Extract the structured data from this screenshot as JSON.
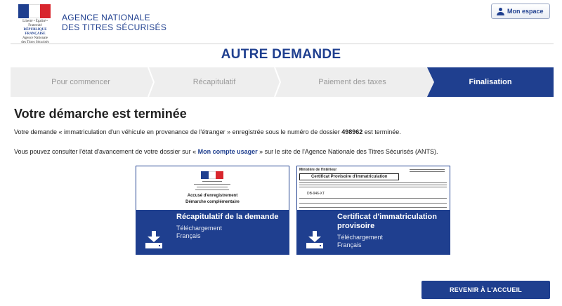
{
  "header": {
    "logo": {
      "motto": "Liberté • Égalité • Fraternité",
      "republic": "RÉPUBLIQUE FRANÇAISE",
      "agency_small_1": "Agence Nationale",
      "agency_small_2": "des Titres Sécurisés",
      "colors": {
        "blue": "#1f3f8f",
        "red": "#d8262d"
      }
    },
    "agency_line1": "AGENCE NATIONALE",
    "agency_line2": "DES TITRES SÉCURISÉS",
    "account_button": {
      "icon": "user-icon",
      "label": "Mon espace"
    }
  },
  "page_title": "AUTRE DEMANDE",
  "steps": [
    {
      "label": "Pour commencer",
      "active": false
    },
    {
      "label": "Récapitulatif",
      "active": false
    },
    {
      "label": "Paiement des taxes",
      "active": false
    },
    {
      "label": "Finalisation",
      "active": true
    }
  ],
  "content": {
    "heading": "Votre démarche est terminée",
    "para1_prefix": "Votre demande « immatriculation d'un véhicule en provenance de l'étranger » enregistrée sous le numéro de dossier ",
    "dossier_number": "498962",
    "para1_suffix": " est terminée.",
    "para2_prefix": "Vous pouvez consulter l'état d'avancement de votre dossier sur « ",
    "para2_link": "Mon compte usager",
    "para2_suffix": " » sur le site de l'Agence Nationale des Titres Sécurisés (ANTS)."
  },
  "cards": [
    {
      "title": "Récapitulatif de la demande",
      "sub1": "Téléchargement",
      "sub2": "Français",
      "icon": "download-icon",
      "thumb": {
        "line1": "Accusé d'enregistrement",
        "line2": "Démarche complémentaire"
      }
    },
    {
      "title": "Certificat d'immatriculation provisoire",
      "sub1": "Téléchargement",
      "sub2": "Français",
      "icon": "download-icon",
      "thumb": {
        "ministry": "Ministère de l'Intérieur",
        "title": "Certificat Provisoire d'Immatriculation",
        "plate": "DB-946-XT"
      }
    }
  ],
  "footer": {
    "back_button": "REVENIR À L'ACCUEIL"
  },
  "colors": {
    "primary": "#1f3f8f",
    "step_bg": "#eeeeee",
    "step_text": "#9a9a9a"
  }
}
